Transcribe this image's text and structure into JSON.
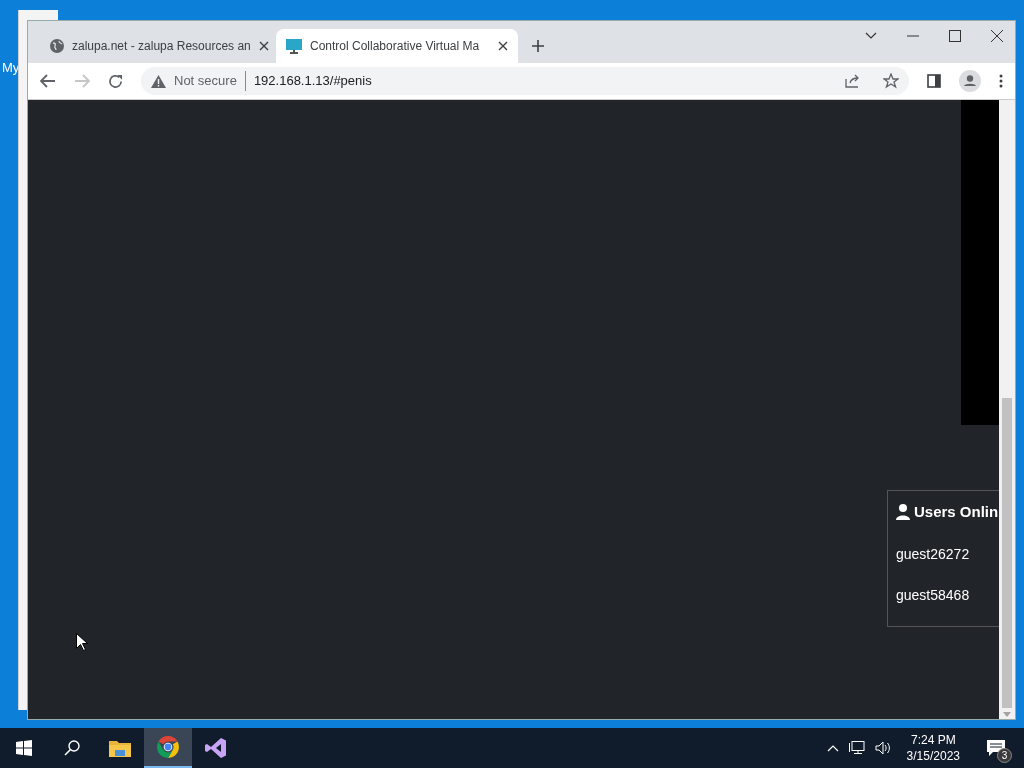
{
  "desktop": {
    "icon_label": "My"
  },
  "browser": {
    "tabs": [
      {
        "title": "zalupa.net - zalupa Resources an",
        "selected": false
      },
      {
        "title": "Control Collaborative Virtual Ma",
        "selected": true
      }
    ],
    "address_bar": {
      "security": "Not secure",
      "url": "192.168.1.13/#penis"
    },
    "users_panel": {
      "title": "Users Onlin",
      "users": [
        "guest26272",
        "guest58468"
      ]
    }
  },
  "taskbar": {
    "apps": [
      {
        "kind": "explorer",
        "active": false
      },
      {
        "kind": "chrome",
        "active": true
      },
      {
        "kind": "studio",
        "active": false
      }
    ],
    "clock": {
      "time": "7:24 PM",
      "date": "3/15/2023"
    },
    "notifications": "3"
  }
}
